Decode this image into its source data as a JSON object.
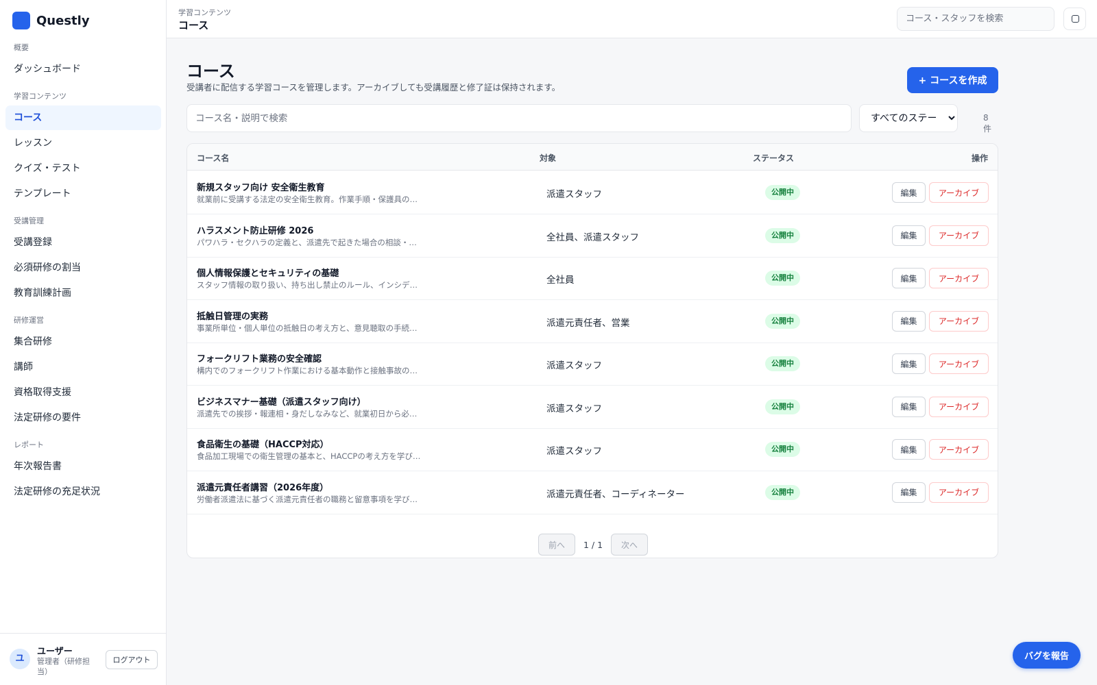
{
  "app": {
    "name": "Questly",
    "accent": "#2563eb"
  },
  "sidebar": {
    "sections": [
      {
        "title": "概要",
        "items": [
          {
            "label": "ダッシュボード"
          }
        ]
      },
      {
        "title": "学習コンテンツ",
        "items": [
          {
            "label": "コース",
            "active": true
          },
          {
            "label": "レッスン"
          },
          {
            "label": "クイズ・テスト"
          },
          {
            "label": "テンプレート"
          }
        ]
      },
      {
        "title": "受講管理",
        "items": [
          {
            "label": "受講登録"
          },
          {
            "label": "必須研修の割当"
          },
          {
            "label": "教育訓練計画"
          }
        ]
      },
      {
        "title": "研修運営",
        "items": [
          {
            "label": "集合研修"
          },
          {
            "label": "講師"
          },
          {
            "label": "資格取得支援"
          },
          {
            "label": "法定研修の要件"
          }
        ]
      },
      {
        "title": "レポート",
        "items": [
          {
            "label": "年次報告書"
          },
          {
            "label": "法定研修の充足状況"
          }
        ]
      }
    ]
  },
  "user": {
    "avatar_initial": "ユ",
    "name": "ユーザー",
    "role": "管理者（研修担当）",
    "logout_label": "ログアウト"
  },
  "topbar": {
    "breadcrumb_parent": "学習コンテンツ",
    "breadcrumb_current": "コース",
    "search_placeholder": "コース・スタッフを検索"
  },
  "page": {
    "title": "コース",
    "description": "受講者に配信する学習コースを管理します。アーカイブしても受講履歴と修了証は保持されます。",
    "create_button": "+ コースを作成",
    "search_placeholder": "コース名・説明で検索",
    "status_filter": {
      "selected": "すべてのステータス"
    },
    "count": "8 件"
  },
  "table": {
    "headers": {
      "name": "コース名",
      "target": "対象",
      "status": "ステータス",
      "actions": "操作"
    },
    "edit_label": "編集",
    "archive_label": "アーカイブ",
    "rows": [
      {
        "name": "新規スタッフ向け 安全衛生教育",
        "desc": "就業前に受講する法定の安全衛生教育。作業手順・保護具の…",
        "target": "派遣スタッフ",
        "status": "公開中"
      },
      {
        "name": "ハラスメント防止研修 2026",
        "desc": "パワハラ・セクハラの定義と、派遣先で起きた場合の相談・…",
        "target": "全社員、派遣スタッフ",
        "status": "公開中"
      },
      {
        "name": "個人情報保護とセキュリティの基礎",
        "desc": "スタッフ情報の取り扱い、持ち出し禁止のルール、インシデ…",
        "target": "全社員",
        "status": "公開中"
      },
      {
        "name": "抵触日管理の実務",
        "desc": "事業所単位・個人単位の抵触日の考え方と、意見聴取の手続…",
        "target": "派遣元責任者、営業",
        "status": "公開中"
      },
      {
        "name": "フォークリフト業務の安全確認",
        "desc": "構内でのフォークリフト作業における基本動作と接触事故の…",
        "target": "派遣スタッフ",
        "status": "公開中"
      },
      {
        "name": "ビジネスマナー基礎（派遣スタッフ向け）",
        "desc": "派遣先での挨拶・報連相・身だしなみなど、就業初日から必…",
        "target": "派遣スタッフ",
        "status": "公開中"
      },
      {
        "name": "食品衛生の基礎（HACCP対応）",
        "desc": "食品加工現場での衛生管理の基本と、HACCPの考え方を学び…",
        "target": "派遣スタッフ",
        "status": "公開中"
      },
      {
        "name": "派遣元責任者講習（2026年度）",
        "desc": "労働者派遣法に基づく派遣元責任者の職務と留意事項を学び…",
        "target": "派遣元責任者、コーディネーター",
        "status": "公開中"
      }
    ]
  },
  "pager": {
    "prev": "前へ",
    "info": "1 / 1",
    "next": "次へ"
  },
  "bug_button": "バグを報告"
}
